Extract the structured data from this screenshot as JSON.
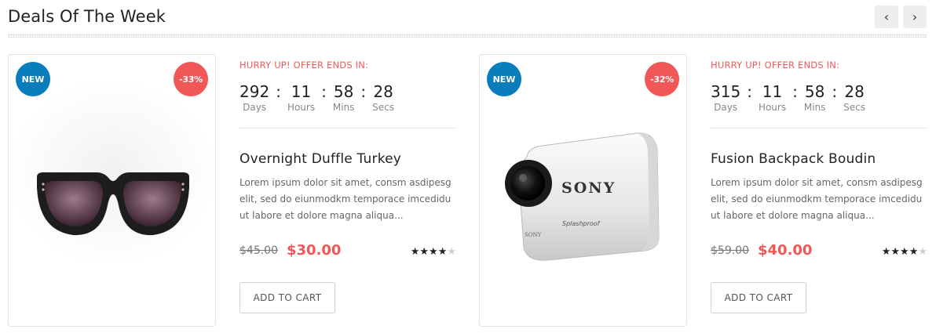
{
  "section": {
    "title": "Deals Of The Week",
    "prev_icon": "‹",
    "next_icon": "›"
  },
  "deals": [
    {
      "badge_new": "NEW",
      "discount": "-33%",
      "hurry": "HURRY UP! OFFER ENDS IN:",
      "countdown": {
        "days": "292",
        "hours": "11",
        "mins": "58",
        "secs": "28"
      },
      "labels": {
        "days": "Days",
        "hours": "Hours",
        "mins": "Mins",
        "secs": "Secs"
      },
      "sep": ":",
      "name": "Overnight Duffle Turkey",
      "description": "Lorem ipsum dolor sit amet, consm asdipesg elit, sed do eiunmodkm temporace imcedidu ut labore et dolore magna aliqua...",
      "old_price": "$45.00",
      "price": "$30.00",
      "rating": 4,
      "cart_label": "ADD TO CART",
      "image_icon": "sunglasses-image"
    },
    {
      "badge_new": "NEW",
      "discount": "-32%",
      "hurry": "HURRY UP! OFFER ENDS IN:",
      "countdown": {
        "days": "315",
        "hours": "11",
        "mins": "58",
        "secs": "28"
      },
      "labels": {
        "days": "Days",
        "hours": "Hours",
        "mins": "Mins",
        "secs": "Secs"
      },
      "sep": ":",
      "name": "Fusion Backpack Boudin",
      "description": "Lorem ipsum dolor sit amet, consm asdipesg elit, sed do eiunmodkm temporace imcedidu ut labore et dolore magna aliqua...",
      "old_price": "$59.00",
      "price": "$40.00",
      "rating": 4,
      "cart_label": "ADD TO CART",
      "image_icon": "action-camera-image",
      "camera_brand": "SONY",
      "camera_text": "Splashproof"
    }
  ],
  "colors": {
    "accent": "#f25757",
    "badge_blue": "#0a7dbd"
  }
}
